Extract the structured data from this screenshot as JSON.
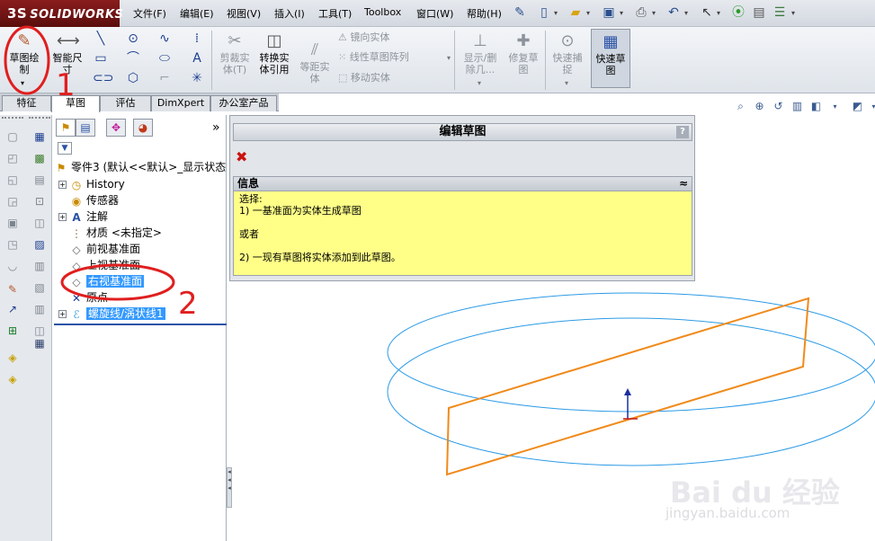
{
  "app": {
    "brand": "SOLIDWORKS",
    "brand_mark": "3S"
  },
  "menu": [
    "文件(F)",
    "编辑(E)",
    "视图(V)",
    "插入(I)",
    "工具(T)",
    "Toolbox",
    "窗口(W)",
    "帮助(H)"
  ],
  "ribbon": {
    "sketch": "草图绘\n制",
    "smart_dim": "智能尺\n寸",
    "trim": "剪裁实\n体(T)",
    "convert": "转换实\n体引用",
    "offset": "等距实\n体",
    "mirror": "镜向实体",
    "linear_pattern": "线性草图阵列",
    "move": "移动实体",
    "show_hide": "显示/删\n除几...",
    "repair": "修复草\n图",
    "quick_snap": "快速捕\n捉",
    "rapid_sketch": "快速草\n图"
  },
  "tabs": [
    "特征",
    "草图",
    "评估",
    "DimXpert",
    "办公室产品"
  ],
  "tree": {
    "root": "零件3 (默认<<默认>_显示状态",
    "items": [
      "History",
      "传感器",
      "注解",
      "材质 <未指定>",
      "前视基准面",
      "上视基准面",
      "右视基准面",
      "原点",
      "螺旋线/涡状线1"
    ]
  },
  "property_manager": {
    "title": "编辑草图",
    "help": "?",
    "info_header": "信息",
    "info_lines": [
      "选择:",
      "1) 一基准面为实体生成草图",
      "",
      "或者",
      "",
      "2) 一现有草图将实体添加到此草图。"
    ]
  },
  "annotations": {
    "step1": "1",
    "step2": "2"
  },
  "watermark": {
    "main": "Bai du 经验",
    "sub": "jingyan.baidu.com"
  },
  "colors": {
    "plane": "#f08a1a",
    "helix": "#2d9be6",
    "selection": "#3399ff",
    "annotation": "#e01f1f",
    "info_bg": "#ffff88"
  }
}
